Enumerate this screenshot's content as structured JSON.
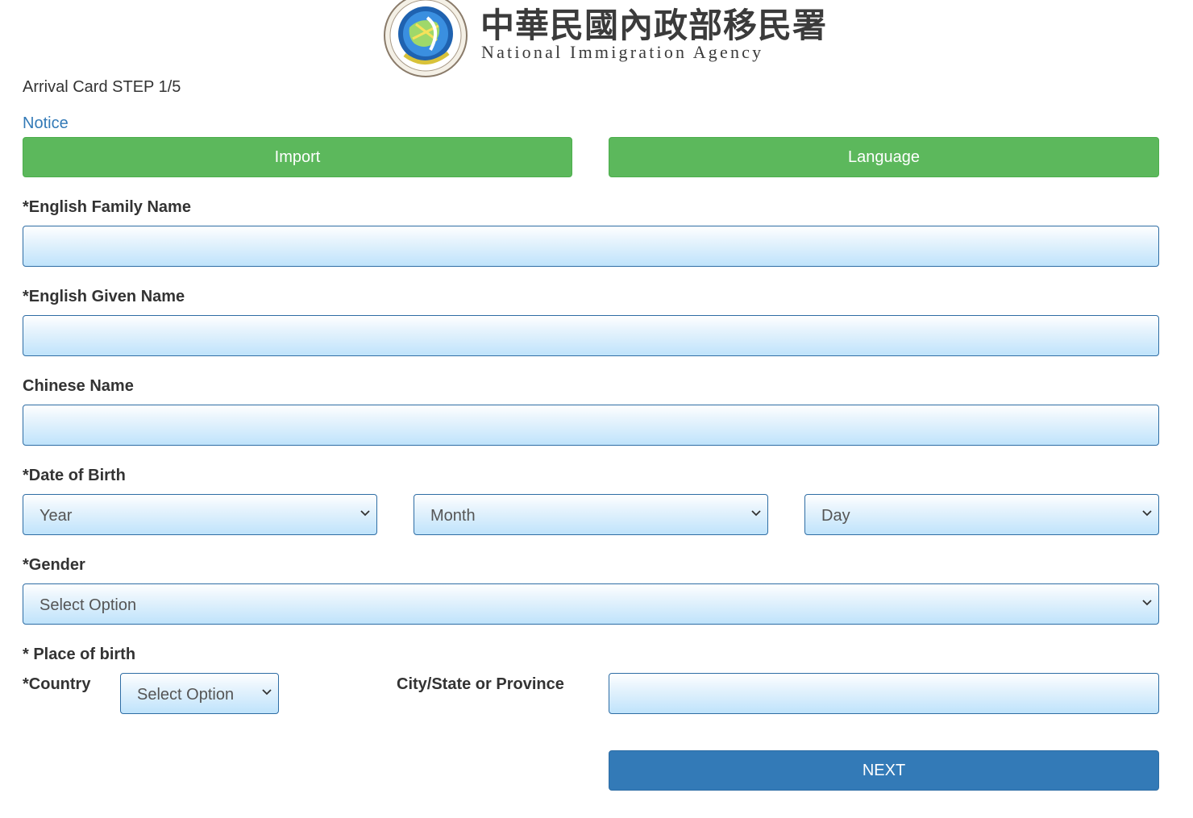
{
  "header": {
    "agency_name_chinese": "中華民國內政部移民署",
    "agency_name_english": "National Immigration Agency",
    "seal_text": "National Immigration Agency"
  },
  "step_title": "Arrival Card STEP 1/5",
  "notice_link": "Notice",
  "buttons": {
    "import": "Import",
    "language": "Language",
    "next": "NEXT"
  },
  "fields": {
    "family_name": {
      "label": "*English Family Name",
      "value": ""
    },
    "given_name": {
      "label": "*English Given Name",
      "value": ""
    },
    "chinese_name": {
      "label": "Chinese Name",
      "value": ""
    },
    "date_of_birth": {
      "label": "*Date of Birth",
      "year": "Year",
      "month": "Month",
      "day": "Day"
    },
    "gender": {
      "label": "*Gender",
      "selected": "Select Option"
    },
    "place_of_birth": {
      "label": "* Place of birth",
      "country_label": "*Country",
      "country_selected": "Select Option",
      "city_label": "City/State or Province",
      "city_value": ""
    }
  },
  "colors": {
    "green_button": "#5cb85c",
    "primary_button": "#337ab7",
    "link": "#337ab7",
    "field_border": "#2e6da4"
  }
}
